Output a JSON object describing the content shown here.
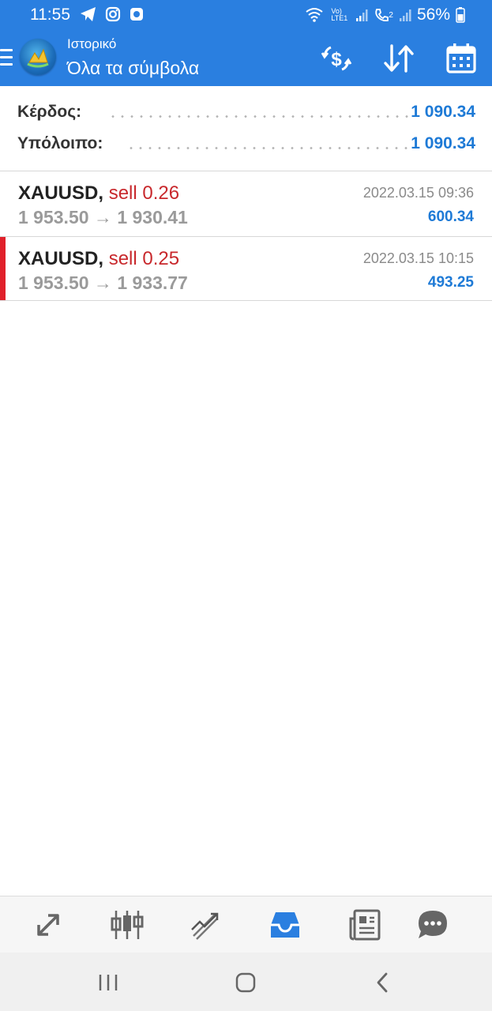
{
  "status_bar": {
    "time": "11:55",
    "left_icons": [
      "telegram-icon",
      "instagram-icon",
      "message-icon"
    ],
    "network_label": "Vo) LTE1",
    "sim_label": "2",
    "battery": "56%"
  },
  "app_bar": {
    "subtitle": "Ιστορικό",
    "title": "Όλα τα σύμβολα",
    "actions": [
      "deposit-withdraw-icon",
      "sort-icon",
      "calendar-icon"
    ]
  },
  "summary": {
    "profit_label": "Κέρδος:",
    "profit_value": "1 090.34",
    "balance_label": "Υπόλοιπο:",
    "balance_value": "1 090.34"
  },
  "trades": [
    {
      "symbol": "XAUUSD",
      "separator": ",",
      "side": "sell 0.26",
      "open_price": "1 953.50",
      "arrow": "→",
      "close_price": "1 930.41",
      "time": "2022.03.15 09:36",
      "profit": "600.34",
      "selected": false
    },
    {
      "symbol": "XAUUSD",
      "separator": ",",
      "side": "sell 0.25",
      "open_price": "1 953.50",
      "arrow": "→",
      "close_price": "1 933.77",
      "time": "2022.03.15 10:15",
      "profit": "493.25",
      "selected": true
    }
  ],
  "bottom_nav": {
    "items": [
      "quotes-icon",
      "chart-icon",
      "trade-icon",
      "history-icon",
      "news-icon",
      "chat-icon"
    ],
    "active": "history-icon"
  },
  "colors": {
    "primary": "#2a7fe0",
    "value_blue": "#1e7ad6",
    "sell_red": "#c8282c",
    "marker_red": "#e0202a",
    "muted_gray": "#9a9a9a"
  }
}
